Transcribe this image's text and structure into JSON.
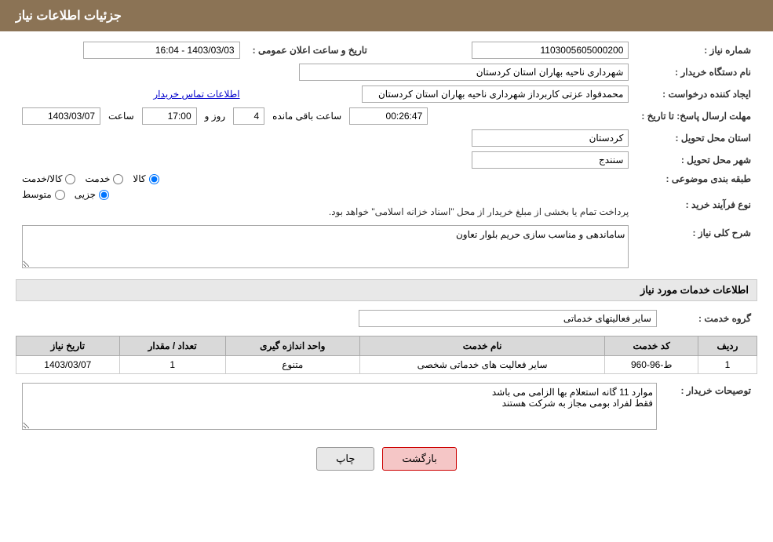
{
  "page": {
    "title": "جزئیات اطلاعات نیاز"
  },
  "header": {
    "title": "جزئیات اطلاعات نیاز"
  },
  "fields": {
    "shomareNiaz_label": "شماره نیاز :",
    "shomareNiaz_value": "1103005605000200",
    "namDastgah_label": "نام دستگاه خریدار :",
    "namDastgah_value": "شهرداری ناحیه بهاران استان کردستان",
    "ijanKonandeh_label": "ایجاد کننده درخواست :",
    "ijanKonandeh_value": "محمدفواد عزتی کاربرداز شهرداری ناحیه بهاران استان کردستان",
    "ettelaat_link": "اطلاعات تماس خریدار",
    "mohlat_label": "مهلت ارسال پاسخ: تا تاریخ :",
    "mohlat_date": "1403/03/07",
    "mohlat_saat_label": "ساعت",
    "mohlat_saat": "17:00",
    "mohlat_roz_label": "روز و",
    "mohlat_roz": "4",
    "mohlat_baghimandeh_label": "ساعت باقی مانده",
    "mohlat_baghimandeh": "00:26:47",
    "tarikh_label": "تاریخ و ساعت اعلان عمومی :",
    "tarikh_value": "1403/03/03 - 16:04",
    "ostan_label": "استان محل تحویل :",
    "ostan_value": "کردستان",
    "shahr_label": "شهر محل تحویل :",
    "shahr_value": "سنندج",
    "tabaqe_label": "طبقه بندی موضوعی :",
    "radio_kala": "کالا",
    "radio_khedmat": "خدمت",
    "radio_kala_khedmat": "کالا/خدمت",
    "noeFarayand_label": "نوع فرآیند خرید :",
    "radio_jozvi": "جزیی",
    "radio_motavasset": "متوسط",
    "purchase_note": "پرداخت تمام یا بخشی از مبلغ خریدار از محل \"اسناد خزانه اسلامی\" خواهد بود.",
    "sharh_label": "شرح کلی نیاز :",
    "sharh_value": "ساماندهی و مناسب سازی حریم بلوار تعاون",
    "services_section_title": "اطلاعات خدمات مورد نیاز",
    "grohe_khedmat_label": "گروه خدمت :",
    "grohe_khedmat_value": "سایر فعالیتهای خدماتی",
    "table": {
      "headers": [
        "ردیف",
        "کد خدمت",
        "نام خدمت",
        "واحد اندازه گیری",
        "تعداد / مقدار",
        "تاریخ نیاز"
      ],
      "rows": [
        {
          "radif": "1",
          "kod_khedmat": "ط-96-960",
          "nam_khedmat": "سایر فعالیت های خدماتی شخصی",
          "vahed": "متنوع",
          "tedad": "1",
          "tarikh": "1403/03/07"
        }
      ]
    },
    "tosiyeh_label": "توصیحات خریدار :",
    "tosiyeh_value": "موارد 11 گانه استعلام بها الزامی می باشد\nفقط لفراد بومی مجاز به شرکت هستند"
  },
  "buttons": {
    "print_label": "چاپ",
    "back_label": "بازگشت"
  }
}
